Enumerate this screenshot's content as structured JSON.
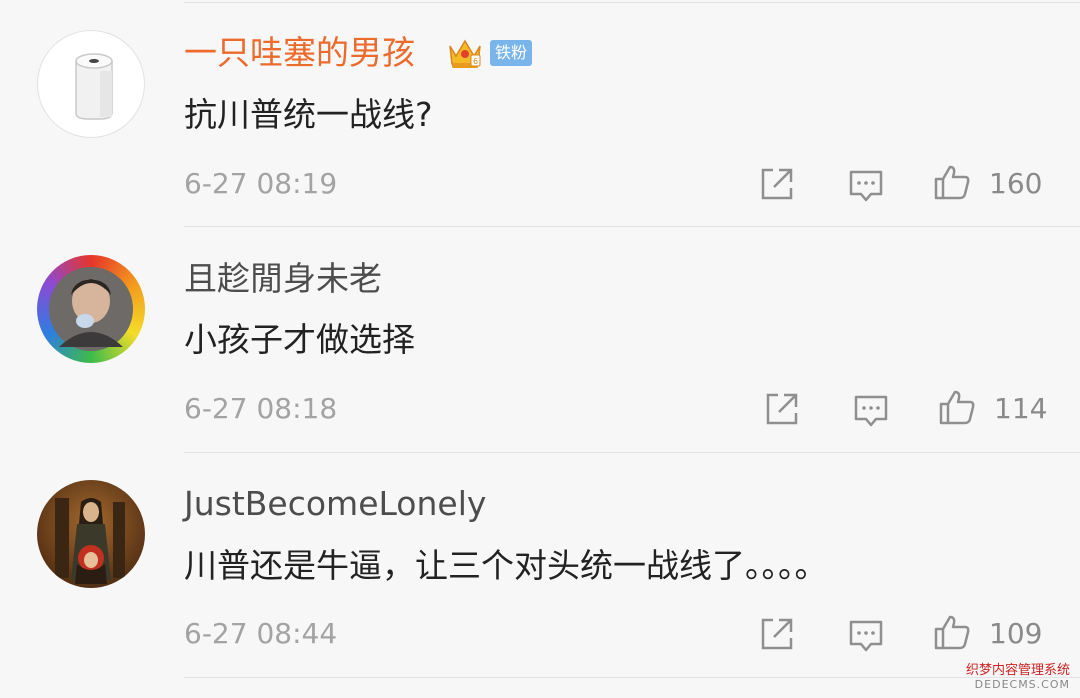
{
  "comments": [
    {
      "username": "一只哇塞的男孩",
      "badge": "铁粉",
      "text": "抗川普统一战线?",
      "time": "6-27 08:19",
      "likes": "160",
      "avatar_icon": "toilet-paper-avatar"
    },
    {
      "username": "且趁閒身未老",
      "text": "小孩子才做选择",
      "time": "6-27 08:18",
      "likes": "114",
      "avatar_icon": "rainbow-ring-person-avatar"
    },
    {
      "username": "JustBecomeLonely",
      "text": "川普还是牛逼，让三个对头统一战线了。。。。",
      "time": "6-27 08:44",
      "likes": "109",
      "avatar_icon": "anime-scene-avatar"
    }
  ],
  "watermark": {
    "line1": "织梦内容管理系统",
    "line2": "DEDECMS.COM"
  },
  "colors": {
    "vip_username": "#ec6a2c",
    "username": "#4d4d4d",
    "fan_badge": "#79b4ea",
    "timestamp": "#a3a3a3"
  }
}
